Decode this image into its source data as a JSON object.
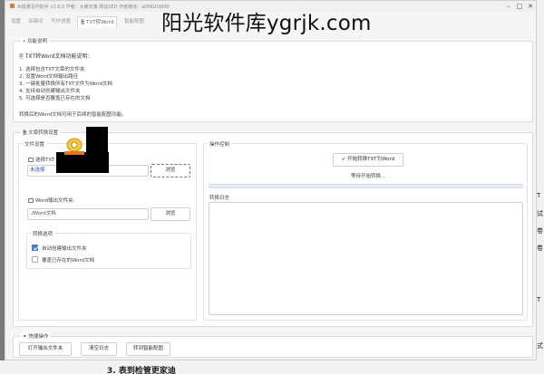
{
  "window": {
    "title": "AI批量写作助手 v1.0.0 作者：大暖天尊 网站SEO 作者微信：aONG03800",
    "watermark": "阳光软件库ygrjk.com"
  },
  "tabs": [
    {
      "label": "设置",
      "active": false
    },
    {
      "label": "关键词",
      "active": false
    },
    {
      "label": "写作进度",
      "active": false
    },
    {
      "label": "TXT转Word",
      "active": true
    },
    {
      "label": "智能配图",
      "active": false
    }
  ],
  "function_desc": {
    "legend": "功能说明",
    "heading": "TXT转Word文档功能说明：",
    "steps": [
      "1. 选择包含TXT文章的文件夹",
      "2. 设置Word文档输出路径",
      "3. 一键批量转换所有TXT文件为Word文档",
      "4. 支持自动创建输出文件夹",
      "5. 可选择是否覆盖已存在的文档"
    ],
    "note": "转换后的Word文档可用于后续的智能配图功能。"
  },
  "convert_settings": {
    "legend": "文章转换设置",
    "file_settings": {
      "legend": "文件设置",
      "txt_folder_label": "选择TXT",
      "txt_folder_value": "未选择",
      "browse_label": "浏览",
      "word_output_label": "Word输出文件夹:",
      "word_output_value": "./Word文档",
      "browse2_label": "浏览"
    },
    "options": {
      "legend": "转换选项",
      "auto_create_label": "自动创建输出文件夹",
      "auto_create_checked": true,
      "overwrite_label": "覆盖已存在的Word文档",
      "overwrite_checked": false
    },
    "operation": {
      "legend": "操作控制",
      "start_label": "开始转换TXT为Word",
      "status": "等待开始转换...",
      "progress_percent": 0,
      "log_legend": "转换日志"
    }
  },
  "quick_actions": {
    "legend": "快捷操作",
    "buttons": [
      "打开输出文件夹",
      "清空日志",
      "转到智能配图"
    ]
  },
  "background": {
    "right_fragments": [
      "T",
      "试",
      "卷",
      "卷",
      "T",
      "式"
    ],
    "bottom_text": "3. 表到检管更家迪"
  },
  "colors": {
    "accent": "#3c7bd8",
    "window_bg": "#f5f5f5",
    "panel_bg": "#ffffff"
  }
}
